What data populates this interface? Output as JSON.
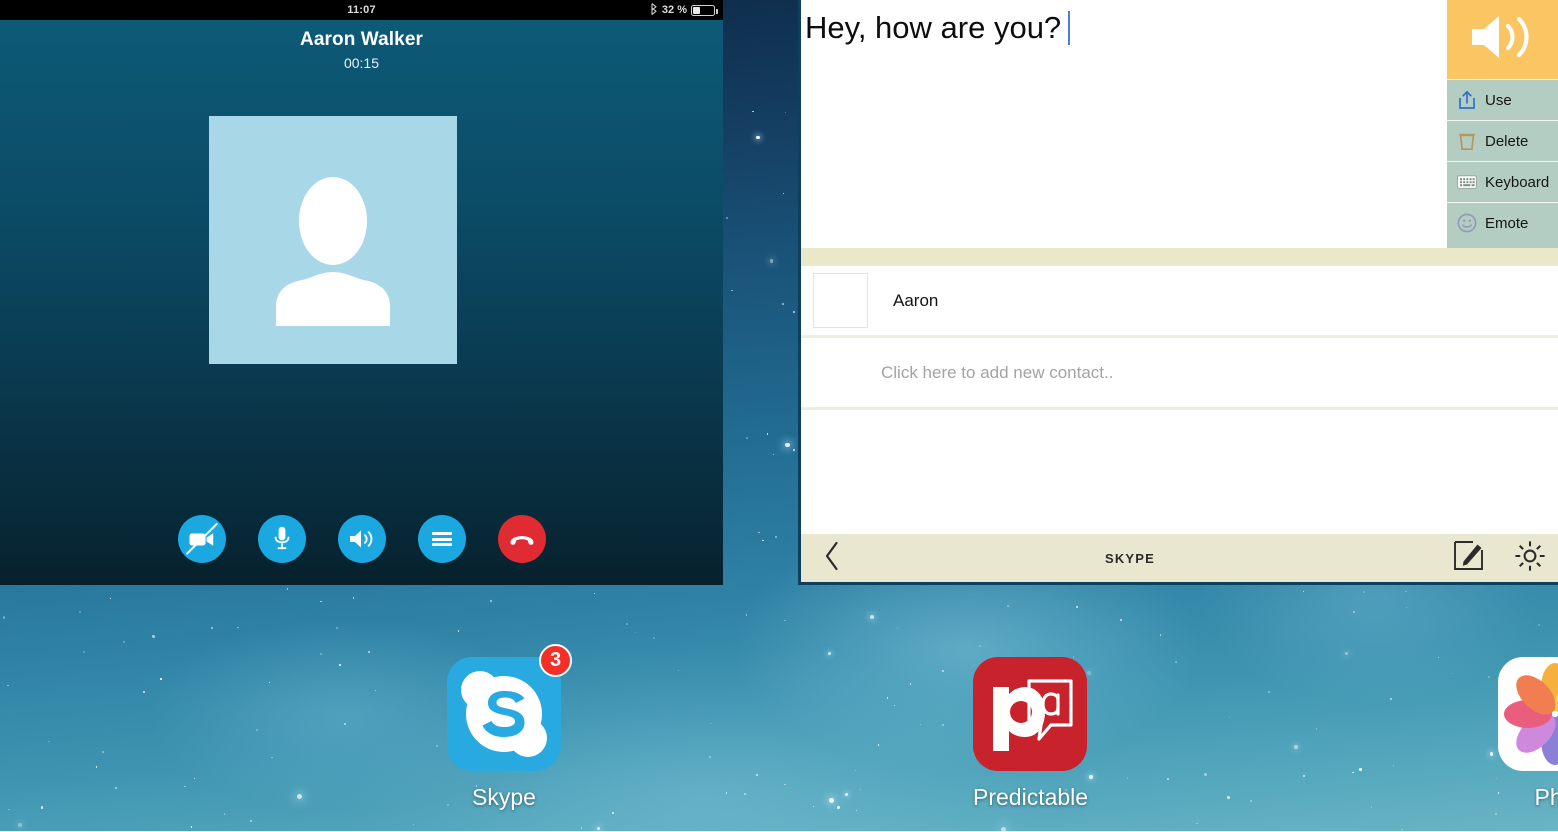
{
  "colors": {
    "skype_blue": "#1ba8e0",
    "skype_end_red": "#e02b32",
    "aac_sidebar_green": "#b3cdc2",
    "aac_speak_orange": "#fbc662",
    "aac_toolbar_beige": "#e9e7cf",
    "aac_band_khaki": "#e9e9c9",
    "badge_red": "#f52f28",
    "caret_blue": "#4a7fd4",
    "avatar_light_blue": "#a8d7e8",
    "predictable_red": "#c8232c"
  },
  "skype_call": {
    "status_bar": {
      "clock": "11:07",
      "bluetooth_icon": "bluetooth-icon",
      "battery_percent": "32 %",
      "battery_level": 32,
      "battery_icon": "battery-icon"
    },
    "callee_name": "Aaron Walker",
    "call_duration": "00:15",
    "avatar_icon": "person-placeholder-icon",
    "controls": [
      {
        "name": "video-off-button",
        "icon": "video-camera-slash-icon",
        "style": "blue"
      },
      {
        "name": "mute-microphone-button",
        "icon": "microphone-icon",
        "style": "blue"
      },
      {
        "name": "speaker-button",
        "icon": "speaker-volume-icon",
        "style": "blue"
      },
      {
        "name": "more-options-button",
        "icon": "hamburger-menu-icon",
        "style": "blue"
      },
      {
        "name": "end-call-button",
        "icon": "phone-hangup-icon",
        "style": "red"
      }
    ]
  },
  "aac_app": {
    "compose": {
      "text": "Hey, how are you?",
      "caret_visible": true
    },
    "sidebar": {
      "speak_button": {
        "label": "",
        "icon": "speaker-loud-icon"
      },
      "items": [
        {
          "label": "Use",
          "icon": "share-up-box-icon"
        },
        {
          "label": "Delete",
          "icon": "trash-can-icon"
        },
        {
          "label": "Keyboard",
          "icon": "keyboard-keypad-icon"
        },
        {
          "label": "Emote",
          "icon": "smiley-face-icon"
        }
      ]
    },
    "contacts": [
      {
        "name": "Aaron",
        "thumb": "empty-contact-thumbnail"
      }
    ],
    "add_contact_placeholder": "Click here to add new contact..",
    "toolbar": {
      "back_icon": "chevron-left-icon",
      "title": "SKYPE",
      "compose_icon": "compose-pencil-square-icon",
      "settings_icon": "gear-icon"
    }
  },
  "home_screen": {
    "apps": [
      {
        "label": "Skype",
        "icon": "skype-logo-icon",
        "badge": "3"
      },
      {
        "label": "Predictable",
        "icon": "predictable-logo-icon",
        "badge": null
      },
      {
        "label": "Pho",
        "icon": "photos-logo-icon",
        "badge": null
      }
    ]
  }
}
